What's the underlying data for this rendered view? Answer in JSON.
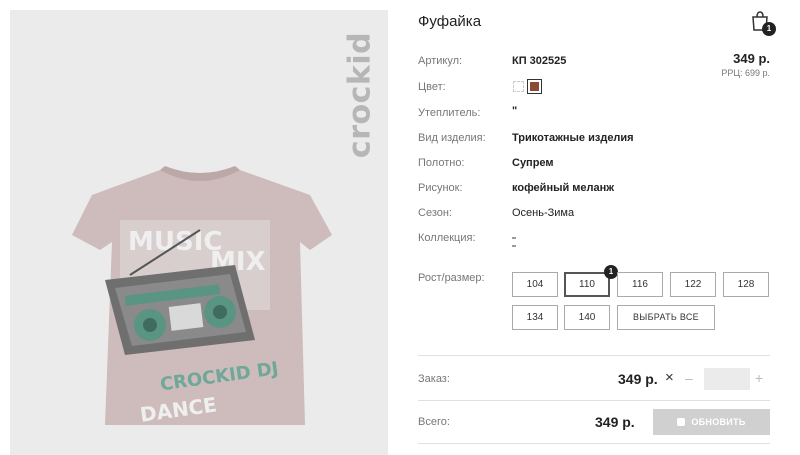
{
  "product": {
    "title": "Фуфайка",
    "brand": "crockid",
    "image_alt": "Фуфайка"
  },
  "cart": {
    "count": "1",
    "icon": "shopping-bag-icon"
  },
  "specs": [
    {
      "label": "Артикул:",
      "value": "КП 302525"
    },
    {
      "label": "Цвет:",
      "value": ""
    },
    {
      "label": "Утеплитель:",
      "value": "\""
    },
    {
      "label": "Вид изделия:",
      "value": "Трикотажные изделия"
    },
    {
      "label": "Полотно:",
      "value": "Супрем"
    },
    {
      "label": "Рисунок:",
      "value": "кофейный меланж"
    },
    {
      "label": "Сезон:",
      "value": "Осень-Зима"
    },
    {
      "label": "Коллекция:",
      "value": ""
    }
  ],
  "pricing": {
    "price": "349 р.",
    "rrp": "РРЦ: 699 р."
  },
  "colors": {
    "options": [
      "#ffffff",
      "#8b4a32"
    ],
    "selected": "#8b4a32"
  },
  "sizes": {
    "label": "Рост/размер:",
    "options": [
      "104",
      "110",
      "116",
      "122",
      "128",
      "134",
      "140"
    ],
    "selected": "110",
    "selected_count": "1",
    "select_all": "ВЫБРАТЬ ВСЕ"
  },
  "order": {
    "label": "Заказ:",
    "price": "349 р.",
    "times": "×",
    "minus": "–",
    "plus": "+",
    "quantity": ""
  },
  "total": {
    "label": "Всего:",
    "price": "349 р.",
    "button": "ОБНОВИТЬ"
  }
}
